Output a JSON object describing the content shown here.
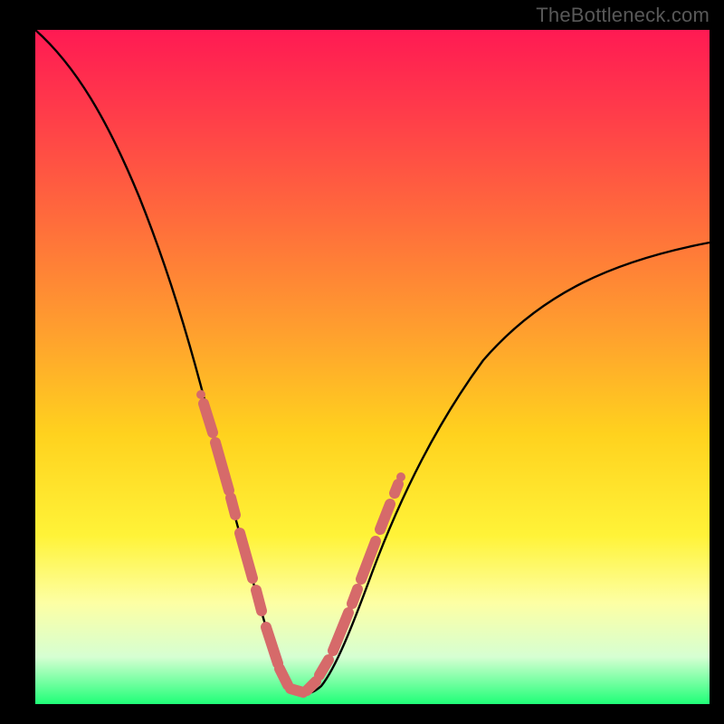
{
  "watermark": "TheBottleneck.com",
  "colors": {
    "frame": "#000000",
    "gradient_top": "#ff1a53",
    "gradient_mid1": "#ffa02e",
    "gradient_mid2": "#fff338",
    "gradient_bottom": "#1fff77",
    "curve": "#000000",
    "curve_thick": "#d66a6a"
  },
  "chart_data": {
    "type": "line",
    "title": "",
    "xlabel": "",
    "ylabel": "",
    "xlim": [
      0,
      1
    ],
    "ylim": [
      0,
      1
    ],
    "series": [
      {
        "name": "curve",
        "x": [
          0.0,
          0.05,
          0.1,
          0.15,
          0.2,
          0.24,
          0.28,
          0.3,
          0.32,
          0.33,
          0.345,
          0.355,
          0.37,
          0.39,
          0.41,
          0.435,
          0.46,
          0.49,
          0.53,
          0.58,
          0.64,
          0.72,
          0.82,
          0.92,
          1.0
        ],
        "y": [
          1.0,
          0.96,
          0.88,
          0.76,
          0.6,
          0.43,
          0.27,
          0.19,
          0.12,
          0.085,
          0.05,
          0.035,
          0.025,
          0.02,
          0.025,
          0.06,
          0.12,
          0.19,
          0.28,
          0.37,
          0.45,
          0.53,
          0.6,
          0.65,
          0.68
        ]
      }
    ],
    "thick_overlay": {
      "name": "highlighted-band",
      "x_range": [
        0.24,
        0.52
      ],
      "note": "pink thickened segment over the curve near the trough"
    }
  }
}
